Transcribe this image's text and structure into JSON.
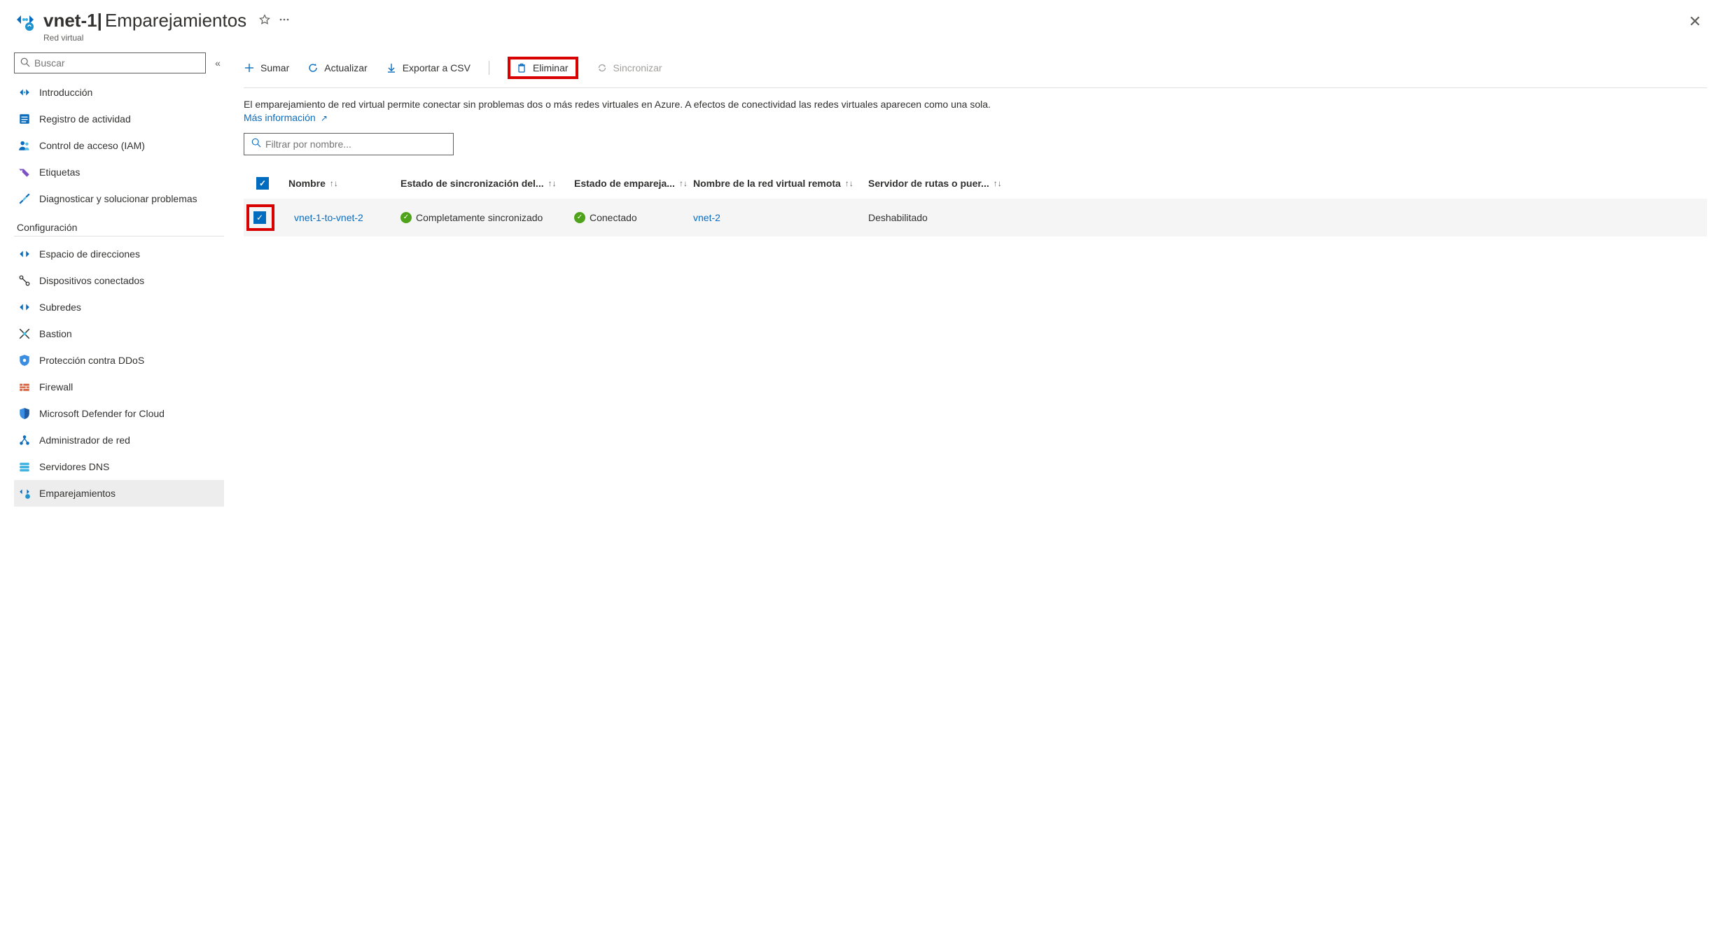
{
  "header": {
    "title_main": "vnet-1",
    "title_separator": " | ",
    "title_sub": "Emparejamientos",
    "subtitle": "Red virtual"
  },
  "sidebar": {
    "search_placeholder": "Buscar",
    "items_top": [
      {
        "label": "Introducción"
      },
      {
        "label": "Registro de actividad"
      },
      {
        "label": "Control de acceso (IAM)"
      },
      {
        "label": "Etiquetas"
      },
      {
        "label": "Diagnosticar y solucionar problemas"
      }
    ],
    "section_label": "Configuración",
    "items_cfg": [
      {
        "label": "Espacio de direcciones"
      },
      {
        "label": "Dispositivos conectados"
      },
      {
        "label": "Subredes"
      },
      {
        "label": "Bastion"
      },
      {
        "label": "Protección contra DDoS"
      },
      {
        "label": "Firewall"
      },
      {
        "label": "Microsoft Defender for Cloud"
      },
      {
        "label": "Administrador de red"
      },
      {
        "label": "Servidores DNS"
      },
      {
        "label": "Emparejamientos"
      }
    ]
  },
  "toolbar": {
    "add": "Sumar",
    "refresh": "Actualizar",
    "export": "Exportar a CSV",
    "delete": "Eliminar",
    "sync": "Sincronizar"
  },
  "description": {
    "text": "El emparejamiento de red virtual permite conectar sin problemas dos o más redes virtuales en Azure. A efectos de conectividad las redes virtuales aparecen como una sola.",
    "learn_more": "Más información"
  },
  "filter_placeholder": "Filtrar por nombre...",
  "table": {
    "columns": {
      "name": "Nombre",
      "sync": "Estado de sincronización del...",
      "peer": "Estado de empareja...",
      "remote": "Nombre de la red virtual remota",
      "route": "Servidor de rutas o puer..."
    },
    "rows": [
      {
        "name": "vnet-1-to-vnet-2",
        "sync": "Completamente sincronizado",
        "peer": "Conectado",
        "remote": "vnet-2",
        "route": "Deshabilitado"
      }
    ]
  }
}
